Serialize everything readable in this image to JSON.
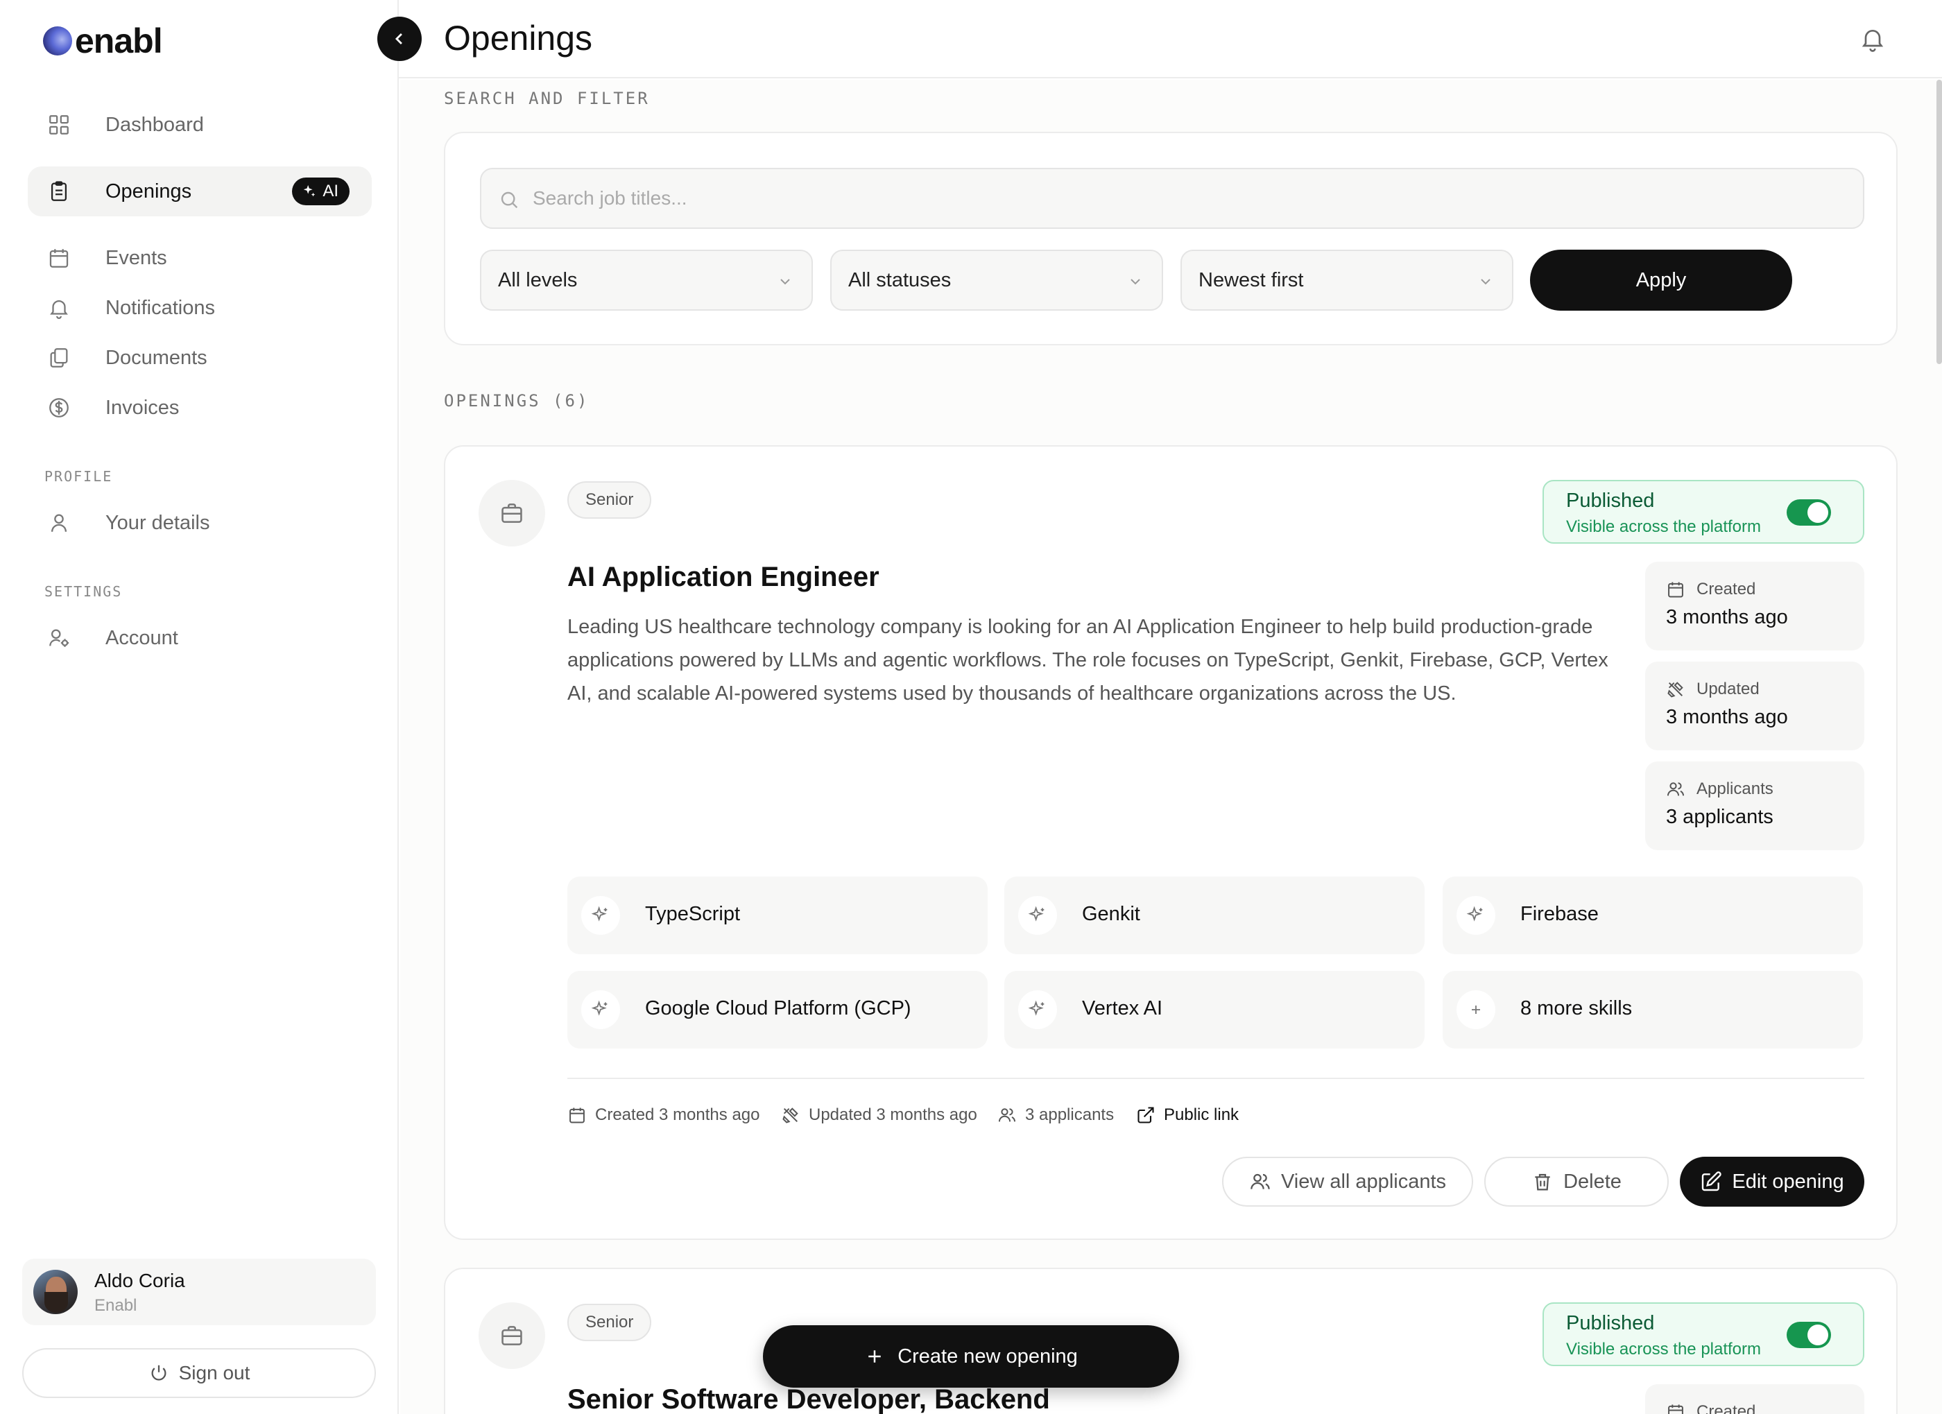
{
  "app": {
    "logo": "enabl"
  },
  "sidebar": {
    "items": [
      {
        "label": "Dashboard",
        "icon": "grid-icon"
      },
      {
        "label": "Openings",
        "icon": "clipboard-icon",
        "active": true,
        "badge": "AI"
      },
      {
        "label": "Events",
        "icon": "calendar-icon"
      },
      {
        "label": "Notifications",
        "icon": "bell-icon"
      },
      {
        "label": "Documents",
        "icon": "documents-icon"
      },
      {
        "label": "Invoices",
        "icon": "dollar-icon"
      }
    ],
    "profile_section": "PROFILE",
    "profile_items": [
      {
        "label": "Your details",
        "icon": "user-icon"
      }
    ],
    "settings_section": "SETTINGS",
    "settings_items": [
      {
        "label": "Account",
        "icon": "user-cog-icon"
      }
    ],
    "user": {
      "name": "Aldo Coria",
      "org": "Enabl"
    },
    "signout": "Sign out"
  },
  "header": {
    "title": "Openings"
  },
  "filters": {
    "section_label": "SEARCH AND FILTER",
    "search_placeholder": "Search job titles...",
    "level": "All levels",
    "status": "All statuses",
    "sort": "Newest first",
    "apply": "Apply"
  },
  "openings_label": "OPENINGS (6)",
  "openings": [
    {
      "level": "Senior",
      "status_title": "Published",
      "status_sub": "Visible across the platform",
      "published": true,
      "title": "AI Application Engineer",
      "description": "Leading US healthcare technology company is looking for an AI Application Engineer to help build production-grade applications powered by LLMs and agentic workflows. The role focuses on TypeScript, Genkit, Firebase, GCP, Vertex AI, and scalable AI-powered systems used by thousands of healthcare organizations across the US.",
      "stats": [
        {
          "label": "Created",
          "value": "3 months ago"
        },
        {
          "label": "Updated",
          "value": "3 months ago"
        },
        {
          "label": "Applicants",
          "value": "3 applicants"
        }
      ],
      "skills": [
        "TypeScript",
        "Genkit",
        "Firebase",
        "Google Cloud Platform (GCP)",
        "Vertex AI"
      ],
      "more_skills": "8 more skills",
      "meta": {
        "created": "Created 3 months ago",
        "updated": "Updated 3 months ago",
        "applicants": "3 applicants",
        "public_link": "Public link"
      },
      "actions": {
        "view": "View all applicants",
        "delete": "Delete",
        "edit": "Edit opening"
      }
    },
    {
      "level": "Senior",
      "status_title": "Published",
      "status_sub": "Visible across the platform",
      "published": true,
      "title": "Senior Software Developer, Backend",
      "stats": [
        {
          "label": "Created"
        }
      ]
    }
  ],
  "fab": {
    "label": "Create new opening"
  },
  "colors": {
    "accent": "#111111",
    "published_bg": "#eefbf3",
    "published_text": "#0b5b35",
    "toggle_on": "#16964f"
  }
}
